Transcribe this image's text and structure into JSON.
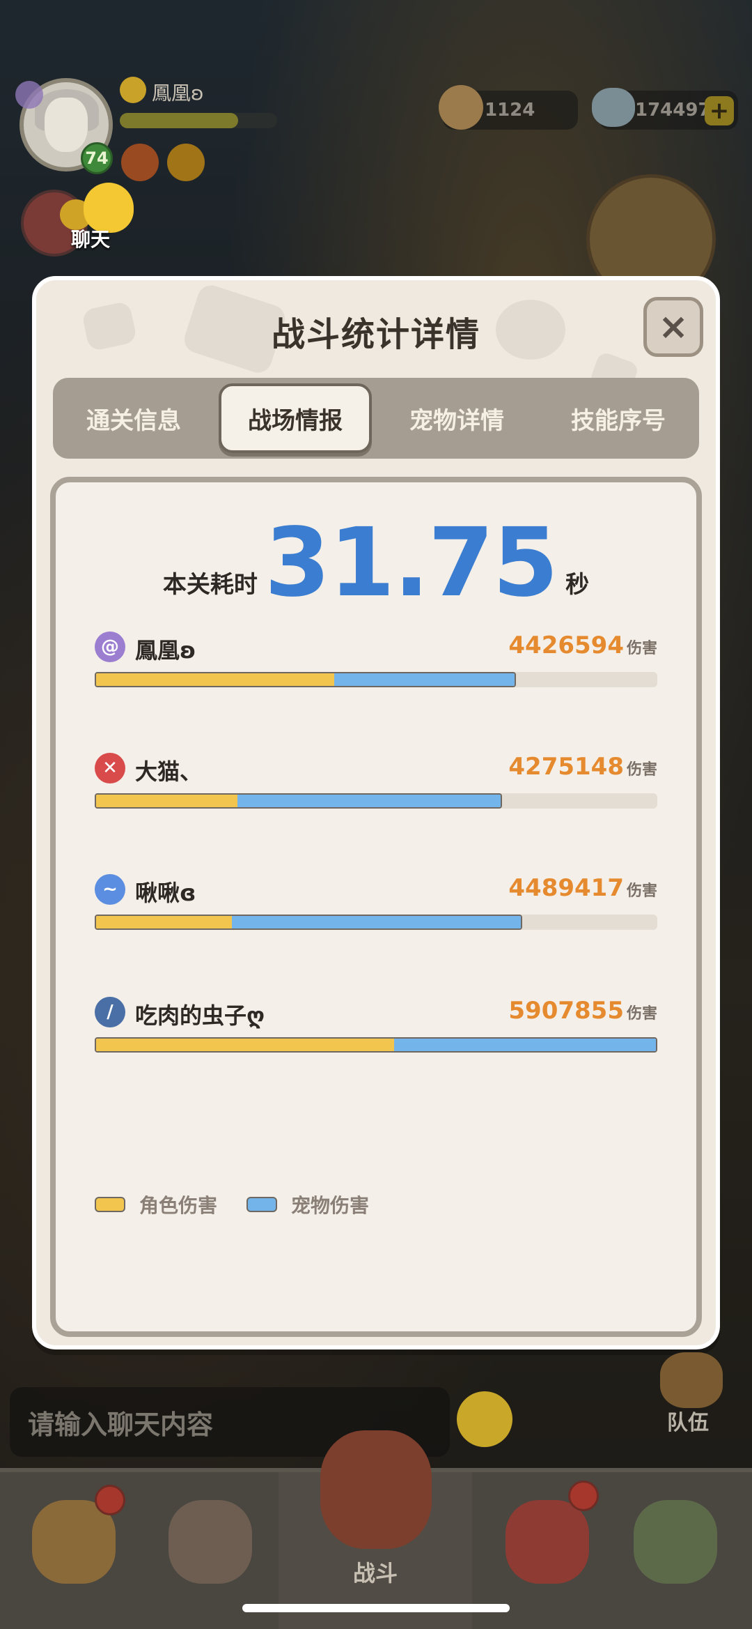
{
  "hud": {
    "player_name": "鳳凰ʚ",
    "level": "74",
    "currency1": "1124",
    "currency2": "174497",
    "plus_label": "+"
  },
  "chat_shortcut": {
    "label": "聊天"
  },
  "modal": {
    "title": "战斗统计详情",
    "close_label": "×",
    "tabs": [
      {
        "label": "通关信息",
        "active": false
      },
      {
        "label": "战场情报",
        "active": true
      },
      {
        "label": "宠物详情",
        "active": false
      },
      {
        "label": "技能序号",
        "active": false
      }
    ],
    "time": {
      "prefix": "本关耗时",
      "value": "31.75",
      "unit": "秒"
    },
    "damage_unit": "伤害",
    "players": [
      {
        "name": "鳳凰ʚ",
        "damage": "4426594",
        "icon": "swirl-icon",
        "icon_color": "#9b7ed0",
        "role_share": 0.423,
        "total_share": 0.749
      },
      {
        "name": "大猫、",
        "damage": "4275148",
        "icon": "cross-blades-icon",
        "icon_color": "#d94b4b",
        "role_share": 0.251,
        "total_share": 0.724
      },
      {
        "name": "啾啾ɞ",
        "damage": "4489417",
        "icon": "wind-icon",
        "icon_color": "#5b8ee0",
        "role_share": 0.241,
        "total_share": 0.76
      },
      {
        "name": "吃肉的虫子ღ",
        "damage": "5907855",
        "icon": "blade-icon",
        "icon_color": "#4a6fa6",
        "role_share": 0.53,
        "total_share": 1.0
      }
    ],
    "legend": [
      {
        "label": "角色伤害",
        "color": "#f2c54f"
      },
      {
        "label": "宠物伤害",
        "color": "#73b4ea"
      }
    ]
  },
  "chat_input": {
    "placeholder": "请输入聊天内容"
  },
  "team_button": {
    "label": "队伍"
  },
  "bottom_nav": {
    "battle_label": "战斗"
  },
  "colors": {
    "time_blue": "#3b7dd0",
    "damage_orange": "#e58a2e",
    "role_yellow": "#f2c54f",
    "pet_blue": "#73b4ea"
  }
}
